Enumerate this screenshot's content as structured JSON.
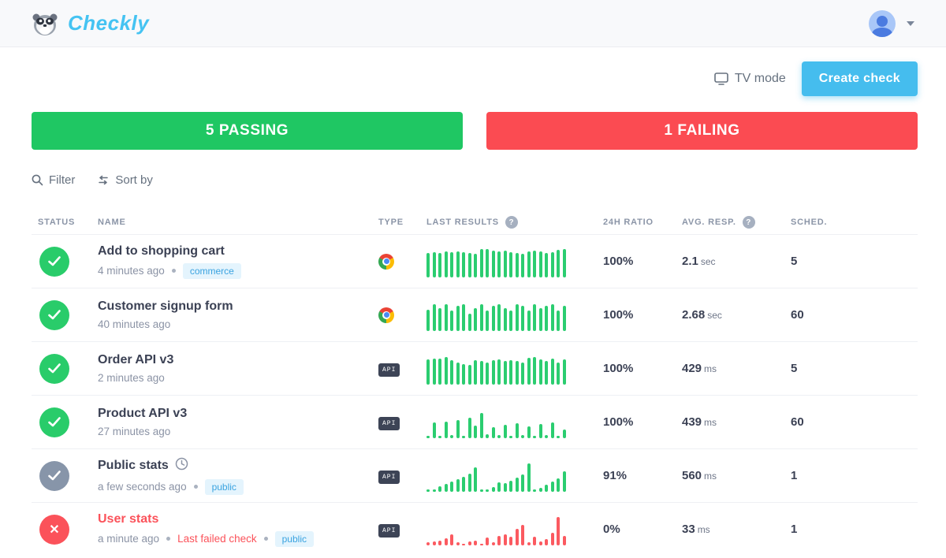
{
  "brand": {
    "name": "Checkly"
  },
  "header": {
    "tv_mode_label": "TV mode",
    "create_check_label": "Create check"
  },
  "summary": {
    "passing_label": "5 PASSING",
    "failing_label": "1 FAILING"
  },
  "toolbar": {
    "filter_label": "Filter",
    "sort_label": "Sort by"
  },
  "table": {
    "columns": {
      "status": "STATUS",
      "name": "NAME",
      "type": "TYPE",
      "last_results": "LAST RESULTS",
      "ratio": "24H RATIO",
      "avg_resp": "AVG. RESP.",
      "sched": "SCHED."
    },
    "help_badge": "?",
    "api_badge_label": "API"
  },
  "colors": {
    "accent": "#45bdee",
    "green": "#2bcd70",
    "red": "#fb5a60",
    "muted_gray": "#8795a9",
    "banner_green": "#1fc763",
    "banner_red": "#fb4b52"
  },
  "checks": [
    {
      "name": "Add to shopping cart",
      "status": "passing",
      "time": "4 minutes ago",
      "fail_link": "",
      "tags": [
        "commerce"
      ],
      "type": "browser",
      "ratio": "100%",
      "avg_value": "2.1",
      "avg_unit": "sec",
      "sched": "5",
      "bar_color": "green",
      "clock_icon": false,
      "bars": [
        31,
        32,
        31,
        33,
        32,
        33,
        32,
        31,
        30,
        36,
        36,
        34,
        33,
        34,
        32,
        31,
        30,
        33,
        34,
        33,
        31,
        32,
        35,
        36
      ]
    },
    {
      "name": "Customer signup form",
      "status": "passing",
      "time": "40 minutes ago",
      "fail_link": "",
      "tags": [],
      "type": "browser",
      "ratio": "100%",
      "avg_value": "2.68",
      "avg_unit": "sec",
      "sched": "60",
      "bar_color": "green",
      "clock_icon": false,
      "bars": [
        27,
        34,
        29,
        34,
        26,
        32,
        34,
        22,
        29,
        34,
        26,
        32,
        34,
        29,
        26,
        34,
        32,
        26,
        34,
        29,
        32,
        34,
        26,
        32
      ]
    },
    {
      "name": "Order API v3",
      "status": "passing",
      "time": "2 minutes ago",
      "fail_link": "",
      "tags": [],
      "type": "api",
      "ratio": "100%",
      "avg_value": "429",
      "avg_unit": "ms",
      "sched": "5",
      "bar_color": "green",
      "clock_icon": false,
      "bars": [
        32,
        33,
        33,
        35,
        31,
        28,
        26,
        25,
        31,
        30,
        28,
        31,
        32,
        30,
        31,
        30,
        28,
        34,
        35,
        32,
        30,
        33,
        28,
        32
      ]
    },
    {
      "name": "Product API v3",
      "status": "passing",
      "time": "27 minutes ago",
      "fail_link": "",
      "tags": [],
      "type": "api",
      "ratio": "100%",
      "avg_value": "439",
      "avg_unit": "ms",
      "sched": "60",
      "bar_color": "green",
      "clock_icon": false,
      "bars": [
        3,
        20,
        3,
        21,
        4,
        23,
        3,
        26,
        16,
        32,
        5,
        14,
        4,
        17,
        3,
        19,
        4,
        15,
        3,
        18,
        4,
        20,
        3,
        11
      ]
    },
    {
      "name": "Public stats",
      "status": "muted",
      "time": "a few seconds ago",
      "fail_link": "",
      "tags": [
        "public"
      ],
      "type": "api",
      "ratio": "91%",
      "avg_value": "560",
      "avg_unit": "ms",
      "sched": "1",
      "bar_color": "green",
      "clock_icon": true,
      "bars": [
        3,
        3,
        7,
        10,
        13,
        16,
        19,
        23,
        31,
        3,
        3,
        6,
        12,
        11,
        14,
        18,
        22,
        36,
        3,
        5,
        9,
        13,
        17,
        26
      ]
    },
    {
      "name": "User stats",
      "status": "failing",
      "time": "a minute ago",
      "fail_link": "Last failed check",
      "tags": [
        "public"
      ],
      "type": "api",
      "ratio": "0%",
      "avg_value": "33",
      "avg_unit": "ms",
      "sched": "1",
      "bar_color": "red",
      "clock_icon": false,
      "bars": [
        4,
        5,
        6,
        9,
        14,
        4,
        2,
        5,
        6,
        2,
        10,
        4,
        12,
        14,
        11,
        21,
        26,
        4,
        11,
        5,
        8,
        16,
        36,
        12
      ]
    }
  ]
}
